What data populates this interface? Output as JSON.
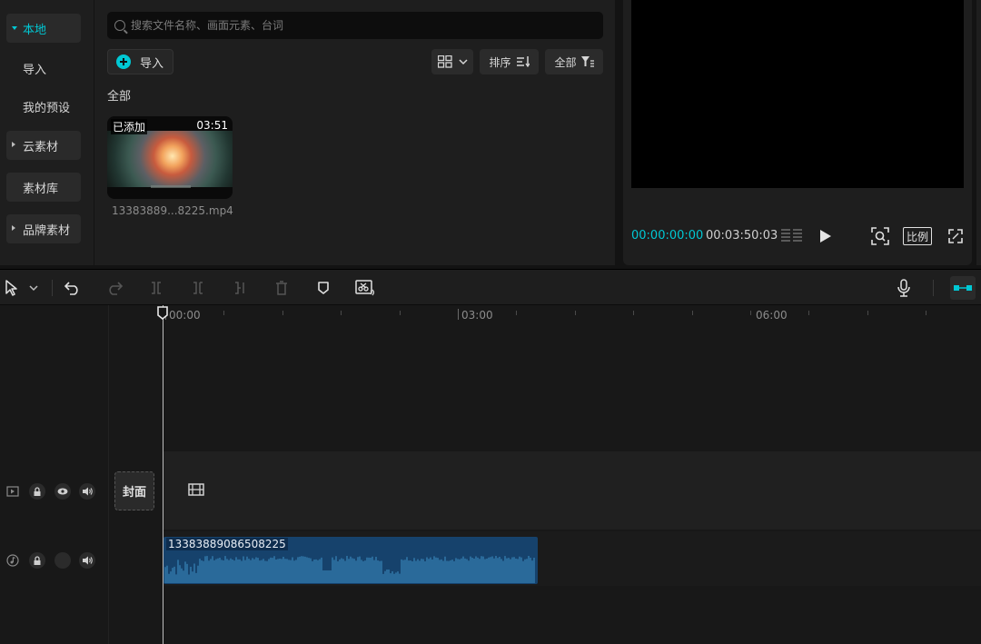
{
  "sidebar": {
    "items": [
      {
        "label": "本地",
        "active": true,
        "expandable": true
      },
      {
        "label": "导入",
        "active": false,
        "expandable": false
      },
      {
        "label": "我的预设",
        "active": false,
        "expandable": false
      },
      {
        "label": "云素材",
        "active": false,
        "expandable": true
      },
      {
        "label": "素材库",
        "active": false,
        "expandable": false
      },
      {
        "label": "品牌素材",
        "active": false,
        "expandable": true
      }
    ]
  },
  "media": {
    "search_placeholder": "搜索文件名称、画面元素、台词",
    "import_label": "导入",
    "sort_label": "排序",
    "filter_label": "全部",
    "section_label": "全部",
    "clip": {
      "added_badge": "已添加",
      "duration": "03:51",
      "file_name": "13383889...8225.mp4"
    }
  },
  "preview": {
    "current_time": "00:00:00:00",
    "total_time": "00:03:50:03",
    "ratio_label": "比例"
  },
  "timeline": {
    "ruler_labels": [
      "00:00",
      "03:00",
      "06:00"
    ],
    "cover_label": "封面",
    "audio_clip_name": "13383889086508225"
  },
  "colors": {
    "accent": "#00c8d4",
    "audio_clip": "#16426c",
    "waveform": "#3f93c9"
  },
  "icons": {
    "toolbar": [
      "select-cursor-icon",
      "chevron-down-icon",
      "undo-icon",
      "redo-icon",
      "split-icon",
      "split-left-icon",
      "split-right-icon",
      "delete-icon",
      "marker-icon",
      "auto-edit-icon",
      "microphone-icon",
      "link-toggle-icon"
    ]
  }
}
